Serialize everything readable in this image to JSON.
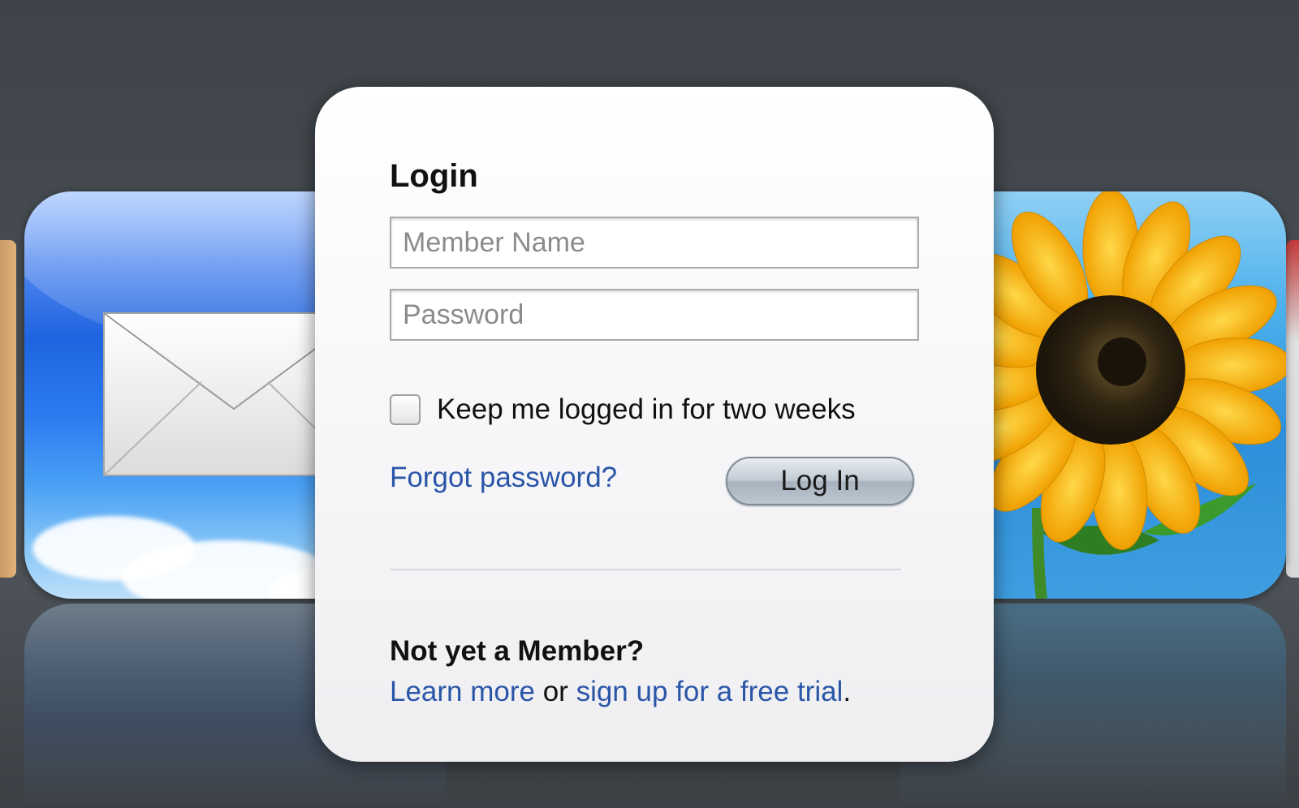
{
  "login": {
    "title": "Login",
    "member_name_placeholder": "Member Name",
    "password_placeholder": "Password",
    "keep_logged_in_label": "Keep me logged in for two weeks",
    "forgot_password_label": "Forgot password?",
    "login_button_label": "Log In"
  },
  "signup": {
    "heading": "Not yet a Member?",
    "learn_more_label": "Learn more",
    "connector_text": " or ",
    "signup_label": "sign up for a free trial",
    "end_punctuation": "."
  },
  "background_icons": {
    "left": "mail-icon",
    "right": "sunflower-photo-icon"
  },
  "colors": {
    "link": "#2b56a8",
    "background": "#474d53",
    "mail_blue": "#2b7af0",
    "sunflower_yellow": "#f7b500"
  }
}
